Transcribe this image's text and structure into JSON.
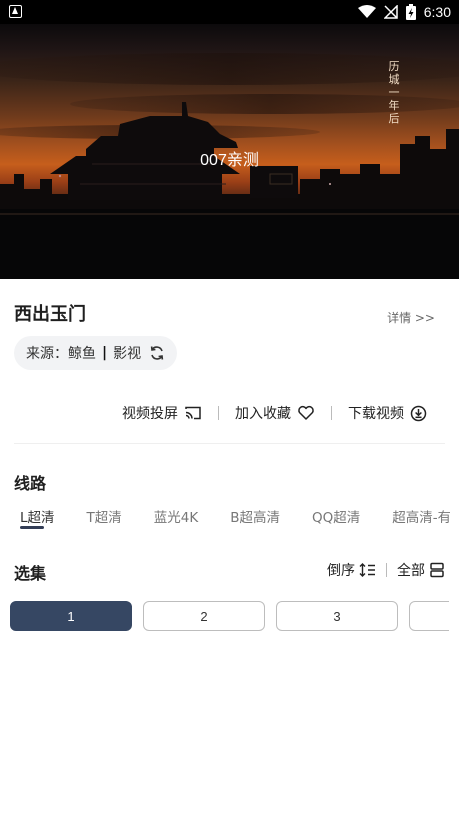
{
  "status_bar": {
    "time": "6:30",
    "icons": [
      "notification-icon",
      "wifi-icon",
      "no-signal-icon",
      "battery-charging-icon"
    ]
  },
  "player": {
    "title": "007亲测",
    "poster_text": "历城一年后"
  },
  "video": {
    "title": "西出玉门",
    "detail_link": "详情 >>",
    "source_prefix": "来源：",
    "source_name": "鲸鱼",
    "source_separator": "|",
    "source_category": "影视",
    "refresh_icon": "refresh-icon"
  },
  "actions": [
    {
      "label": "视频投屏",
      "icon": "cast-icon"
    },
    {
      "label": "加入收藏",
      "icon": "heart-icon"
    },
    {
      "label": "下载视频",
      "icon": "download-icon"
    }
  ],
  "routes": {
    "heading": "线路",
    "items": [
      "L超清",
      "T超清",
      "蓝光4K",
      "B超高清",
      "QQ超清",
      "超高清-有"
    ],
    "active_index": 0
  },
  "episodes": {
    "heading": "选集",
    "sort_label": "倒序",
    "sort_icon": "sort-icon",
    "all_label": "全部",
    "all_icon": "grid-icon",
    "items": [
      "1",
      "2",
      "3",
      ""
    ],
    "active_index": 0
  },
  "colors": {
    "accent": "#364763",
    "indicator": "#333d55"
  }
}
